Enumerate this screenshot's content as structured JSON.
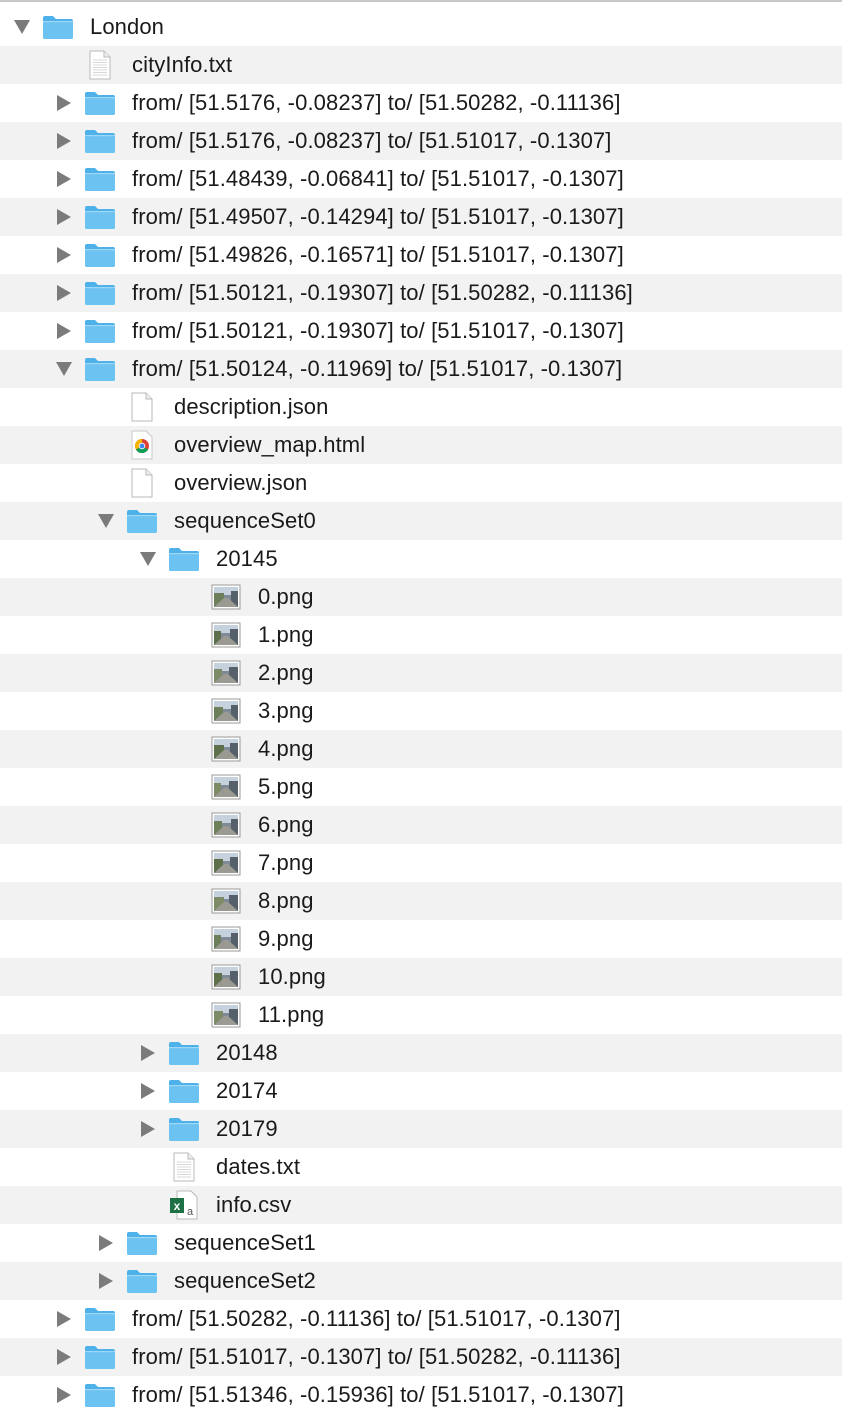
{
  "colors": {
    "folder_front": "#6cc2f0",
    "folder_back": "#4fb1ea",
    "row_alt": "#f2f2f2",
    "disclosure": "#7b7b7b",
    "text": "#1a1a1a"
  },
  "rows": [
    {
      "level": 0,
      "type": "folder",
      "expanded": true,
      "name": "London"
    },
    {
      "level": 1,
      "type": "text-file",
      "name": "cityInfo.txt"
    },
    {
      "level": 1,
      "type": "folder",
      "expanded": false,
      "name": "from/ [51.5176, -0.08237] to/ [51.50282, -0.11136]"
    },
    {
      "level": 1,
      "type": "folder",
      "expanded": false,
      "name": "from/ [51.5176, -0.08237] to/ [51.51017, -0.1307]"
    },
    {
      "level": 1,
      "type": "folder",
      "expanded": false,
      "name": "from/ [51.48439, -0.06841] to/ [51.51017, -0.1307]"
    },
    {
      "level": 1,
      "type": "folder",
      "expanded": false,
      "name": "from/ [51.49507, -0.14294] to/ [51.51017, -0.1307]"
    },
    {
      "level": 1,
      "type": "folder",
      "expanded": false,
      "name": "from/ [51.49826, -0.16571] to/ [51.51017, -0.1307]"
    },
    {
      "level": 1,
      "type": "folder",
      "expanded": false,
      "name": "from/ [51.50121, -0.19307] to/ [51.50282, -0.11136]"
    },
    {
      "level": 1,
      "type": "folder",
      "expanded": false,
      "name": "from/ [51.50121, -0.19307] to/ [51.51017, -0.1307]"
    },
    {
      "level": 1,
      "type": "folder",
      "expanded": true,
      "name": "from/ [51.50124, -0.11969] to/ [51.51017, -0.1307]"
    },
    {
      "level": 2,
      "type": "blank-file",
      "name": "description.json"
    },
    {
      "level": 2,
      "type": "chrome-file",
      "name": "overview_map.html"
    },
    {
      "level": 2,
      "type": "blank-file",
      "name": "overview.json"
    },
    {
      "level": 2,
      "type": "folder",
      "expanded": true,
      "name": "sequenceSet0"
    },
    {
      "level": 3,
      "type": "folder",
      "expanded": true,
      "name": "20145"
    },
    {
      "level": 4,
      "type": "image-file",
      "name": "0.png"
    },
    {
      "level": 4,
      "type": "image-file",
      "name": "1.png"
    },
    {
      "level": 4,
      "type": "image-file",
      "name": "2.png"
    },
    {
      "level": 4,
      "type": "image-file",
      "name": "3.png"
    },
    {
      "level": 4,
      "type": "image-file",
      "name": "4.png"
    },
    {
      "level": 4,
      "type": "image-file",
      "name": "5.png"
    },
    {
      "level": 4,
      "type": "image-file",
      "name": "6.png"
    },
    {
      "level": 4,
      "type": "image-file",
      "name": "7.png"
    },
    {
      "level": 4,
      "type": "image-file",
      "name": "8.png"
    },
    {
      "level": 4,
      "type": "image-file",
      "name": "9.png"
    },
    {
      "level": 4,
      "type": "image-file",
      "name": "10.png"
    },
    {
      "level": 4,
      "type": "image-file",
      "name": "11.png"
    },
    {
      "level": 3,
      "type": "folder",
      "expanded": false,
      "name": "20148"
    },
    {
      "level": 3,
      "type": "folder",
      "expanded": false,
      "name": "20174"
    },
    {
      "level": 3,
      "type": "folder",
      "expanded": false,
      "name": "20179"
    },
    {
      "level": 3,
      "type": "text-file",
      "name": "dates.txt"
    },
    {
      "level": 3,
      "type": "excel-file",
      "name": "info.csv"
    },
    {
      "level": 2,
      "type": "folder",
      "expanded": false,
      "name": "sequenceSet1"
    },
    {
      "level": 2,
      "type": "folder",
      "expanded": false,
      "name": "sequenceSet2"
    },
    {
      "level": 1,
      "type": "folder",
      "expanded": false,
      "name": "from/ [51.50282, -0.11136] to/ [51.51017, -0.1307]"
    },
    {
      "level": 1,
      "type": "folder",
      "expanded": false,
      "name": "from/ [51.51017, -0.1307] to/ [51.50282, -0.11136]"
    },
    {
      "level": 1,
      "type": "folder",
      "expanded": false,
      "name": "from/ [51.51346, -0.15936] to/ [51.51017, -0.1307]"
    }
  ]
}
